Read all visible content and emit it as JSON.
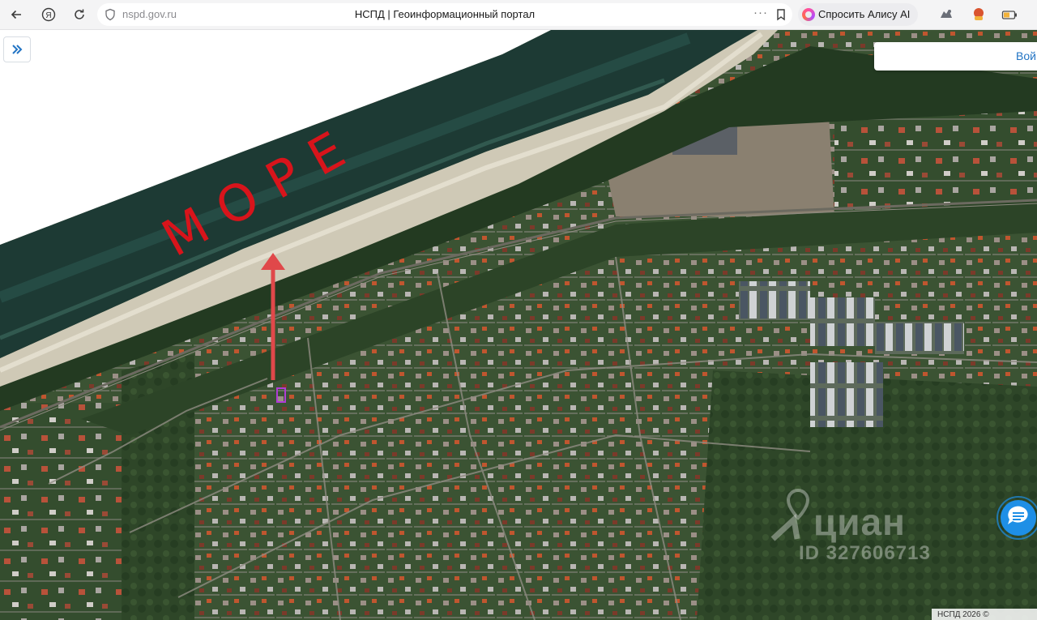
{
  "browser": {
    "url": "nspd.gov.ru",
    "tab_title": "НСПД | Геоинформационный портал",
    "more_glyph": "···",
    "alice_label": "Спросить Алису AI",
    "yandex_glyph": "Я"
  },
  "map": {
    "annotation_text": "МОРЕ",
    "login_label": "Вой",
    "expand_glyph": "»",
    "footer_note": "НСПД 2026 ©",
    "watermark_brand": "циан",
    "watermark_id": "ID 327606713"
  },
  "colors": {
    "sea": "#1d3a34",
    "beach": "#cfc9b6",
    "forest": "#2f4a2a",
    "annotation_red": "#d8141b",
    "arrow": "#e0484a",
    "accent_blue": "#2274c4",
    "chat_blue": "#1e8fe6"
  },
  "icons": [
    "back-icon",
    "yandex-icon",
    "reload-icon",
    "shield-icon",
    "bookmark-icon",
    "alice-icon",
    "extension-icon",
    "chevron-double-right-icon",
    "chat-icon",
    "location-pin-icon"
  ]
}
